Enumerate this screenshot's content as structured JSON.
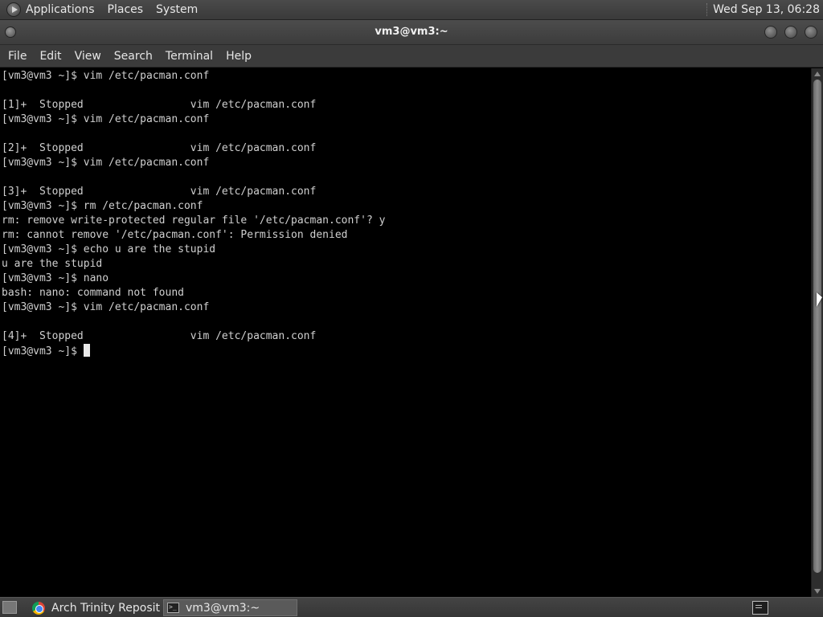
{
  "top_panel": {
    "menus": [
      "Applications",
      "Places",
      "System"
    ],
    "clock": "Wed Sep 13, 06:28"
  },
  "window": {
    "title": "vm3@vm3:~"
  },
  "menubar": {
    "items": [
      "File",
      "Edit",
      "View",
      "Search",
      "Terminal",
      "Help"
    ]
  },
  "terminal": {
    "lines": [
      "[vm3@vm3 ~]$ vim /etc/pacman.conf",
      "",
      "[1]+  Stopped                 vim /etc/pacman.conf",
      "[vm3@vm3 ~]$ vim /etc/pacman.conf",
      "",
      "[2]+  Stopped                 vim /etc/pacman.conf",
      "[vm3@vm3 ~]$ vim /etc/pacman.conf",
      "",
      "[3]+  Stopped                 vim /etc/pacman.conf",
      "[vm3@vm3 ~]$ rm /etc/pacman.conf",
      "rm: remove write-protected regular file '/etc/pacman.conf'? y",
      "rm: cannot remove '/etc/pacman.conf': Permission denied",
      "[vm3@vm3 ~]$ echo u are the stupid",
      "u are the stupid",
      "[vm3@vm3 ~]$ nano",
      "bash: nano: command not found",
      "[vm3@vm3 ~]$ vim /etc/pacman.conf",
      "",
      "[4]+  Stopped                 vim /etc/pacman.conf"
    ],
    "prompt": "[vm3@vm3 ~]$ "
  },
  "taskbar": {
    "tasks": [
      {
        "label": "Arch Trinity Reposit...",
        "icon": "chrome-icon",
        "active": false
      },
      {
        "label": "vm3@vm3:~",
        "icon": "terminal-icon",
        "active": true
      }
    ]
  }
}
